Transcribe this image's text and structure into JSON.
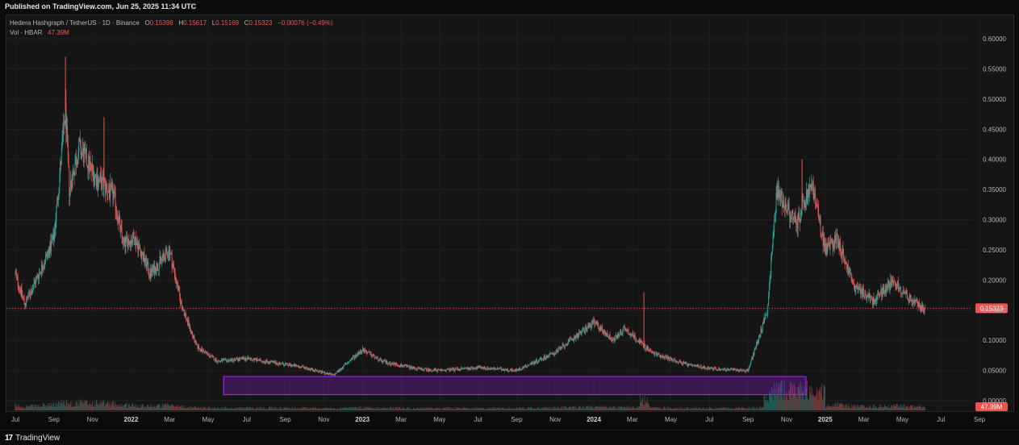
{
  "header": {
    "published_text": "Published on TradingView.com, Jun 25, 2025 11:34 UTC"
  },
  "legend": {
    "symbol": "Hedera Hashgraph / TetherUS · 1D · Binance",
    "o_label": "O",
    "o_value": "0.15398",
    "h_label": "H",
    "h_value": "0.15617",
    "l_label": "L",
    "l_value": "0.15169",
    "c_label": "C",
    "c_value": "0.15323",
    "change": "−0.00076 (−0.49%)",
    "vol_label": "Vol · HBAR",
    "vol_value": "47.39M"
  },
  "footer": {
    "brand": "TradingView",
    "logo_glyph": "17"
  },
  "colors": {
    "background": "#151516",
    "up": "#26a69a",
    "down": "#ef5350",
    "highlight_box": "#a020f0",
    "price_line": "#ef5350"
  },
  "chart_data": {
    "type": "candlestick",
    "title": "Hedera Hashgraph / TetherUS · 1D · Binance",
    "y_axis_labels": [
      "0.60000",
      "0.55000",
      "0.50000",
      "0.45000",
      "0.40000",
      "0.35000",
      "0.30000",
      "0.25000",
      "0.20000",
      "0.15000",
      "0.10000",
      "0.05000",
      "0.00000"
    ],
    "y_axis_values": [
      0.6,
      0.55,
      0.5,
      0.45,
      0.4,
      0.35,
      0.3,
      0.25,
      0.2,
      0.15,
      0.1,
      0.05,
      0.0
    ],
    "ylim": [
      0.0,
      0.62
    ],
    "x_axis_labels": [
      {
        "label": "Jul",
        "bold": false
      },
      {
        "label": "Sep",
        "bold": false
      },
      {
        "label": "Nov",
        "bold": false
      },
      {
        "label": "2022",
        "bold": true
      },
      {
        "label": "Mar",
        "bold": false
      },
      {
        "label": "May",
        "bold": false
      },
      {
        "label": "Jul",
        "bold": false
      },
      {
        "label": "Sep",
        "bold": false
      },
      {
        "label": "Nov",
        "bold": false
      },
      {
        "label": "2023",
        "bold": true
      },
      {
        "label": "Mar",
        "bold": false
      },
      {
        "label": "May",
        "bold": false
      },
      {
        "label": "Jul",
        "bold": false
      },
      {
        "label": "Sep",
        "bold": false
      },
      {
        "label": "Nov",
        "bold": false
      },
      {
        "label": "2024",
        "bold": true
      },
      {
        "label": "Mar",
        "bold": false
      },
      {
        "label": "May",
        "bold": false
      },
      {
        "label": "Jul",
        "bold": false
      },
      {
        "label": "Sep",
        "bold": false
      },
      {
        "label": "Nov",
        "bold": false
      },
      {
        "label": "2025",
        "bold": true
      },
      {
        "label": "Mar",
        "bold": false
      },
      {
        "label": "May",
        "bold": false
      },
      {
        "label": "Jul",
        "bold": false
      },
      {
        "label": "Sep",
        "bold": false
      }
    ],
    "series_key_points": [
      {
        "month_index": 0,
        "price": 0.21
      },
      {
        "month_index": 0.5,
        "price": 0.16
      },
      {
        "month_index": 1.5,
        "price": 0.23
      },
      {
        "month_index": 2.0,
        "price": 0.27
      },
      {
        "month_index": 2.6,
        "price": 0.48
      },
      {
        "month_index": 2.8,
        "price": 0.35
      },
      {
        "month_index": 3.3,
        "price": 0.42
      },
      {
        "month_index": 4.2,
        "price": 0.37
      },
      {
        "month_index": 5.1,
        "price": 0.34
      },
      {
        "month_index": 5.6,
        "price": 0.26
      },
      {
        "month_index": 6.2,
        "price": 0.27
      },
      {
        "month_index": 7.0,
        "price": 0.21
      },
      {
        "month_index": 8.0,
        "price": 0.25
      },
      {
        "month_index": 8.6,
        "price": 0.16
      },
      {
        "month_index": 9.4,
        "price": 0.09
      },
      {
        "month_index": 10.5,
        "price": 0.065
      },
      {
        "month_index": 12.0,
        "price": 0.07
      },
      {
        "month_index": 13.0,
        "price": 0.065
      },
      {
        "month_index": 15.0,
        "price": 0.055
      },
      {
        "month_index": 16.5,
        "price": 0.042
      },
      {
        "month_index": 18.0,
        "price": 0.085
      },
      {
        "month_index": 19.0,
        "price": 0.065
      },
      {
        "month_index": 21.0,
        "price": 0.052
      },
      {
        "month_index": 22.0,
        "price": 0.05
      },
      {
        "month_index": 24.0,
        "price": 0.055
      },
      {
        "month_index": 26.0,
        "price": 0.05
      },
      {
        "month_index": 28.0,
        "price": 0.08
      },
      {
        "month_index": 30.0,
        "price": 0.13
      },
      {
        "month_index": 31.0,
        "price": 0.1
      },
      {
        "month_index": 31.6,
        "price": 0.12
      },
      {
        "month_index": 33.0,
        "price": 0.08
      },
      {
        "month_index": 35.0,
        "price": 0.058
      },
      {
        "month_index": 36.5,
        "price": 0.052
      },
      {
        "month_index": 38.0,
        "price": 0.05
      },
      {
        "month_index": 39.0,
        "price": 0.15
      },
      {
        "month_index": 39.5,
        "price": 0.35
      },
      {
        "month_index": 40.5,
        "price": 0.29
      },
      {
        "month_index": 41.3,
        "price": 0.36
      },
      {
        "month_index": 42.0,
        "price": 0.25
      },
      {
        "month_index": 42.6,
        "price": 0.27
      },
      {
        "month_index": 43.5,
        "price": 0.19
      },
      {
        "month_index": 44.5,
        "price": 0.165
      },
      {
        "month_index": 45.5,
        "price": 0.2
      },
      {
        "month_index": 46.5,
        "price": 0.165
      },
      {
        "month_index": 47.2,
        "price": 0.15
      }
    ],
    "spikes": [
      {
        "month_index": 2.6,
        "high": 0.57
      },
      {
        "month_index": 4.6,
        "high": 0.47
      },
      {
        "month_index": 32.6,
        "high": 0.18
      },
      {
        "month_index": 40.8,
        "high": 0.4
      }
    ],
    "current_price": 0.15323,
    "current_price_label": "0.15323",
    "volume_label": "47.39M",
    "highlight_zone": {
      "price_low": 0.01,
      "price_high": 0.04,
      "month_start": 10.8,
      "month_end": 41.0
    }
  }
}
